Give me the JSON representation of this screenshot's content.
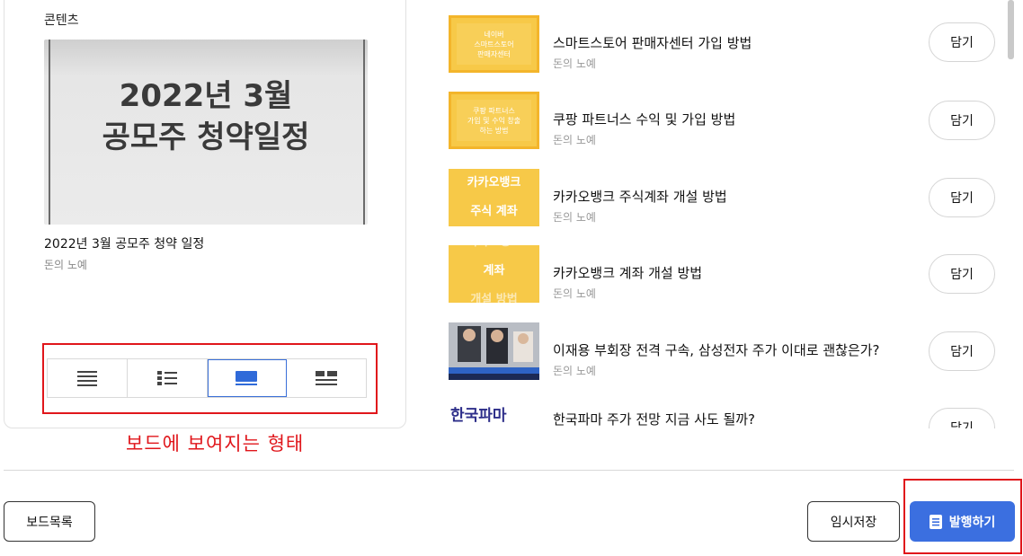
{
  "preview": {
    "section_label": "콘텐츠",
    "thumbnail_lines": [
      "2022년 3월",
      "공모주 청약일정"
    ],
    "title": "2022년 3월 공모주 청약 일정",
    "author": "돈의 노예",
    "view_modes": [
      "text-list",
      "thumb-list",
      "card",
      "grid"
    ],
    "active_view": "card"
  },
  "annotation": {
    "caption": "보드에 보여지는 형태",
    "color": "#e0161b"
  },
  "content_list": {
    "items": [
      {
        "title": "스마트스토어 판매자센터 가입 방법",
        "author": "돈의 노예",
        "thumb_text": [
          "네이버",
          "스마트스토어",
          "판매자센터"
        ],
        "save_label": "담기"
      },
      {
        "title": "쿠팡 파트너스 수익 및 가입 방법",
        "author": "돈의 노예",
        "thumb_text": [
          "쿠팡 파트너스",
          "가입 및 수익 창출",
          "하는 방법"
        ],
        "save_label": "담기"
      },
      {
        "title": "카카오뱅크 주식계좌 개설 방법",
        "author": "돈의 노예",
        "thumb_text": [
          "카카오뱅크",
          "주식 계좌"
        ],
        "save_label": "담기"
      },
      {
        "title": "카카오뱅크 계좌 개설 방법",
        "author": "돈의 노예",
        "thumb_text": [
          "카카오뱅크",
          "계좌",
          "개설 방법"
        ],
        "save_label": "담기"
      },
      {
        "title": "이재용 부회장 전격 구속, 삼성전자 주가 이대로 괜찮은가?",
        "author": "돈의 노예",
        "thumb_text": [],
        "save_label": "담기"
      },
      {
        "title": "한국파마 주가 전망 지금 사도 될까?",
        "author": "",
        "thumb_text": [
          "한국파마"
        ],
        "save_label": "담기"
      }
    ]
  },
  "footer": {
    "board_list_label": "보드목록",
    "draft_label": "임시저장",
    "publish_label": "발행하기",
    "publish_color": "#3b6fe0"
  }
}
